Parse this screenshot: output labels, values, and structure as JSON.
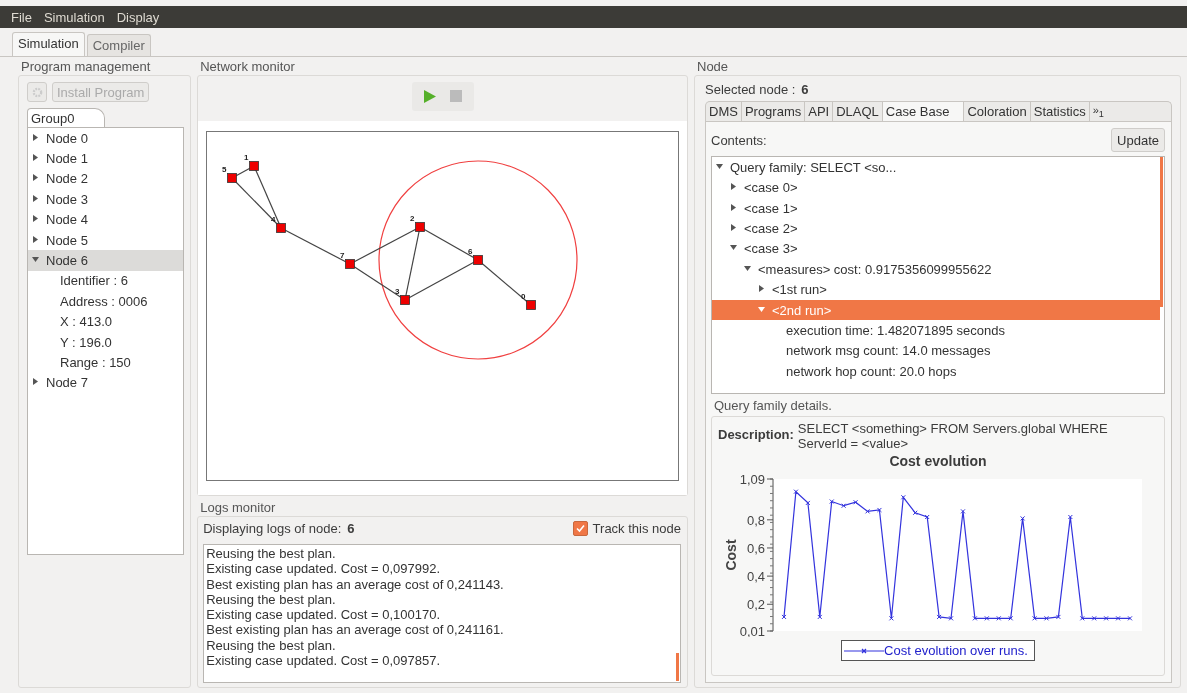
{
  "menu": [
    {
      "label": "File"
    },
    {
      "label": "Simulation"
    },
    {
      "label": "Display"
    }
  ],
  "tabs": [
    {
      "label": "Simulation",
      "selected": true
    },
    {
      "label": "Compiler",
      "selected": false
    }
  ],
  "program_management": {
    "title": "Program management",
    "install_button": {
      "label": "Install Program",
      "disabled": true
    },
    "group_tab": "Group0",
    "tree": [
      {
        "label": "Node 0",
        "expanded": false,
        "selected": false
      },
      {
        "label": "Node 1",
        "expanded": false,
        "selected": false
      },
      {
        "label": "Node 2",
        "expanded": false,
        "selected": false
      },
      {
        "label": "Node 3",
        "expanded": false,
        "selected": false
      },
      {
        "label": "Node 4",
        "expanded": false,
        "selected": false
      },
      {
        "label": "Node 5",
        "expanded": false,
        "selected": false
      },
      {
        "label": "Node 6",
        "expanded": true,
        "selected": true,
        "children": [
          {
            "label": "Identifier : 6",
            "selected": false
          },
          {
            "label": "Address : 0006",
            "selected": false
          },
          {
            "label": "X : 413.0",
            "selected": false
          },
          {
            "label": "Y : 196.0",
            "selected": false
          },
          {
            "label": "Range : 150",
            "selected": false
          }
        ]
      },
      {
        "label": "Node 7",
        "expanded": false,
        "selected": false
      }
    ]
  },
  "network_monitor": {
    "title": "Network monitor",
    "graph": {
      "nodes": [
        {
          "label": "0",
          "selected": false
        },
        {
          "label": "1",
          "selected": false
        },
        {
          "label": "2",
          "selected": false
        },
        {
          "label": "3",
          "selected": false
        },
        {
          "label": "4",
          "selected": false
        },
        {
          "label": "5",
          "selected": false
        },
        {
          "label": "6",
          "selected": true
        },
        {
          "label": "7",
          "selected": false
        }
      ]
    }
  },
  "logs_monitor": {
    "title": "Logs monitor",
    "displaying_label": "Displaying logs of node:",
    "node": "6",
    "track": {
      "label": "Track this node",
      "checked": true
    },
    "lines": [
      "Reusing the best plan.",
      "Existing case updated. Cost = 0,097992.",
      "Best existing plan has an average cost of 0,241143.",
      "Reusing the best plan.",
      "Existing case updated. Cost = 0,100170.",
      "Best existing plan has an average cost of 0,241161.",
      "Reusing the best plan.",
      "Existing case updated. Cost = 0,097857."
    ]
  },
  "node_panel": {
    "title": "Node",
    "selected_label": "Selected node :",
    "selected_value": "6",
    "tabs": [
      {
        "label": "DMS",
        "selected": false
      },
      {
        "label": "Programs",
        "selected": false
      },
      {
        "label": "API",
        "selected": false
      },
      {
        "label": "DLAQL",
        "selected": false
      },
      {
        "label": "Case Base",
        "selected": true
      },
      {
        "label": "Coloration",
        "selected": false
      },
      {
        "label": "Statistics",
        "selected": false
      }
    ],
    "tabs_overflow": "»$_{1}$",
    "contents_label": "Contents:",
    "update_button": "Update",
    "tree": [
      {
        "label": "Query family: SELECT <so...",
        "expanded": true,
        "selected": false,
        "children": [
          {
            "label": "<case 0>",
            "expanded": false,
            "selected": false
          },
          {
            "label": "<case 1>",
            "expanded": false,
            "selected": false
          },
          {
            "label": "<case 2>",
            "expanded": false,
            "selected": false
          },
          {
            "label": "<case 3>",
            "expanded": true,
            "selected": false,
            "children": [
              {
                "label": "<measures> cost: 0.9175356099955622",
                "expanded": true,
                "selected": false,
                "children": [
                  {
                    "label": "<1st run>",
                    "expanded": false,
                    "selected": false
                  },
                  {
                    "label": "<2nd run>",
                    "expanded": true,
                    "selected": true,
                    "children": [
                      {
                        "label": "execution time: 1.482071895 seconds",
                        "selected": false
                      },
                      {
                        "label": "network msg count: 14.0 messages",
                        "selected": false
                      },
                      {
                        "label": "network hop count: 20.0 hops",
                        "selected": false
                      }
                    ]
                  }
                ]
              }
            ]
          }
        ]
      }
    ],
    "details": {
      "title": "Query family details.",
      "description_label": "Description:",
      "description": "SELECT <something> FROM Servers.global WHERE ServerId = <value>",
      "chart_data": {
        "type": "line",
        "title": "Cost evolution",
        "ylabel": "Cost",
        "ylim": [
          0.01,
          1.09
        ],
        "yticks": [
          {
            "value": 0.01,
            "label": "0,01"
          },
          {
            "value": 0.2,
            "label": "0,2"
          },
          {
            "value": 0.4,
            "label": "0,4"
          },
          {
            "value": 0.6,
            "label": "0,6"
          },
          {
            "value": 0.8,
            "label": "0,8"
          },
          {
            "value": 1.09,
            "label": "1,09"
          }
        ],
        "series": [
          {
            "name": "Cost evolution over runs.",
            "color": "#3333dd",
            "marker": "x",
            "values": [
              0.11,
              1.0,
              0.92,
              0.11,
              0.93,
              0.9,
              0.925,
              0.86,
              0.87,
              0.1,
              0.96,
              0.85,
              0.82,
              0.11,
              0.1,
              0.86,
              0.1,
              0.1,
              0.1,
              0.1,
              0.81,
              0.1,
              0.1,
              0.11,
              0.82,
              0.1,
              0.1,
              0.1,
              0.1,
              0.1
            ]
          }
        ]
      }
    }
  }
}
